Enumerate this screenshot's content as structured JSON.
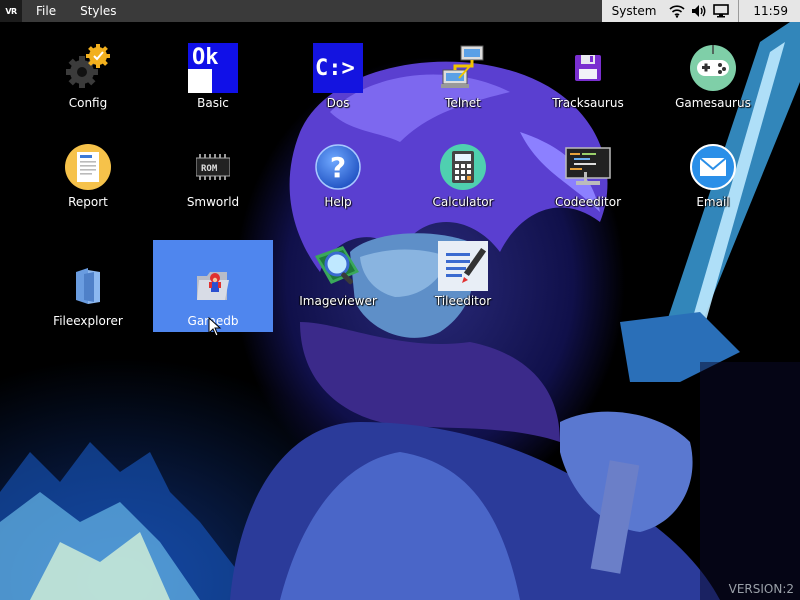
{
  "menubar": {
    "logo": "VR",
    "items": [
      "File",
      "Styles"
    ]
  },
  "tray": {
    "system_label": "System",
    "icons": [
      "wifi-icon",
      "volume-icon",
      "monitor-icon"
    ],
    "clock": "11:59"
  },
  "desktop": {
    "icons": [
      {
        "label": "Config",
        "icon": "gear-check-icon"
      },
      {
        "label": "Basic",
        "icon": "basic-ok-icon"
      },
      {
        "label": "Dos",
        "icon": "dos-prompt-icon"
      },
      {
        "label": "Telnet",
        "icon": "network-terminal-icon"
      },
      {
        "label": "Tracksaurus",
        "icon": "floppy-disk-icon"
      },
      {
        "label": "Gamesaurus",
        "icon": "gamepad-icon"
      },
      {
        "label": "Report",
        "icon": "report-document-icon"
      },
      {
        "label": "Smworld",
        "icon": "chip-icon"
      },
      {
        "label": "Help",
        "icon": "help-icon"
      },
      {
        "label": "Calculator",
        "icon": "calculator-icon"
      },
      {
        "label": "Codeeditor",
        "icon": "code-monitor-icon"
      },
      {
        "label": "Email",
        "icon": "email-icon"
      },
      {
        "label": "Fileexplorer",
        "icon": "folder-icon"
      },
      {
        "label": "Gamedb",
        "icon": "game-folder-icon",
        "selected": true
      },
      {
        "label": "Imageviewer",
        "icon": "image-magnifier-icon"
      },
      {
        "label": "Tileeditor",
        "icon": "tile-edit-icon"
      }
    ]
  },
  "basic_icon_text": "Ok",
  "dos_icon_text": "C:>",
  "smworld_icon_text": "ROM",
  "help_icon_text": "?",
  "version": "VERSION:2",
  "colors": {
    "menubar": "#3a3a3a",
    "tray": "#e6e6e6",
    "selection": "#4f86ee"
  }
}
